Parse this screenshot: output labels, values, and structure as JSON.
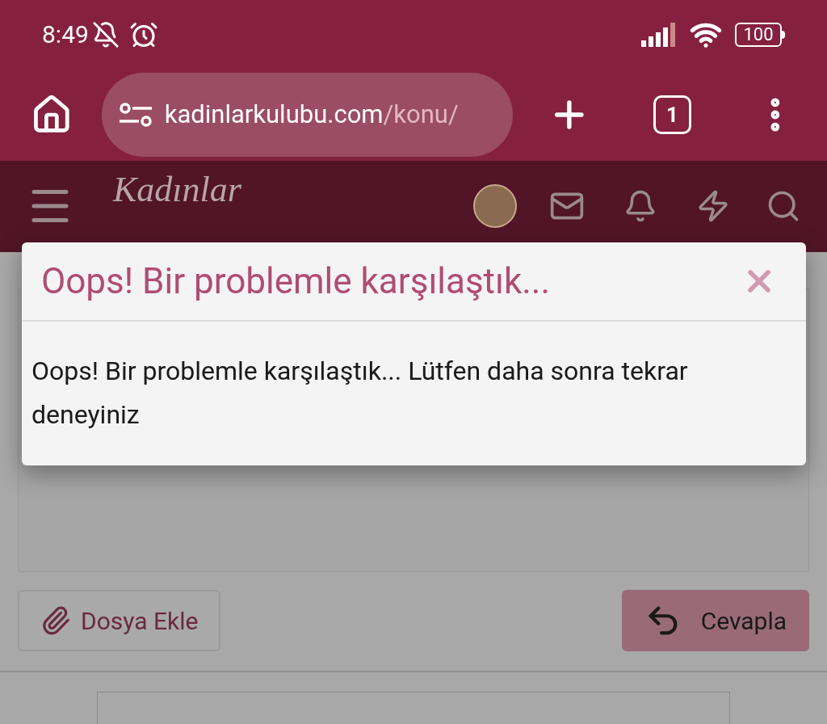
{
  "status_bar": {
    "time": "8:49",
    "battery": "100"
  },
  "browser": {
    "url_domain": "kadinlarkulubu.com",
    "url_path": "/konu/",
    "tab_count": "1"
  },
  "site_header": {
    "logo": "Kadınlar"
  },
  "dialog": {
    "title": "Oops! Bir problemle karşılaştık...",
    "message": "Oops! Bir problemle karşılaştık... Lütfen daha sonra tekrar deneyiniz"
  },
  "reply_form": {
    "buttons": [
      {
        "kind": "attach",
        "label": "Dosya Ekle"
      },
      {
        "kind": "submit",
        "label": "Cevapla"
      }
    ]
  }
}
